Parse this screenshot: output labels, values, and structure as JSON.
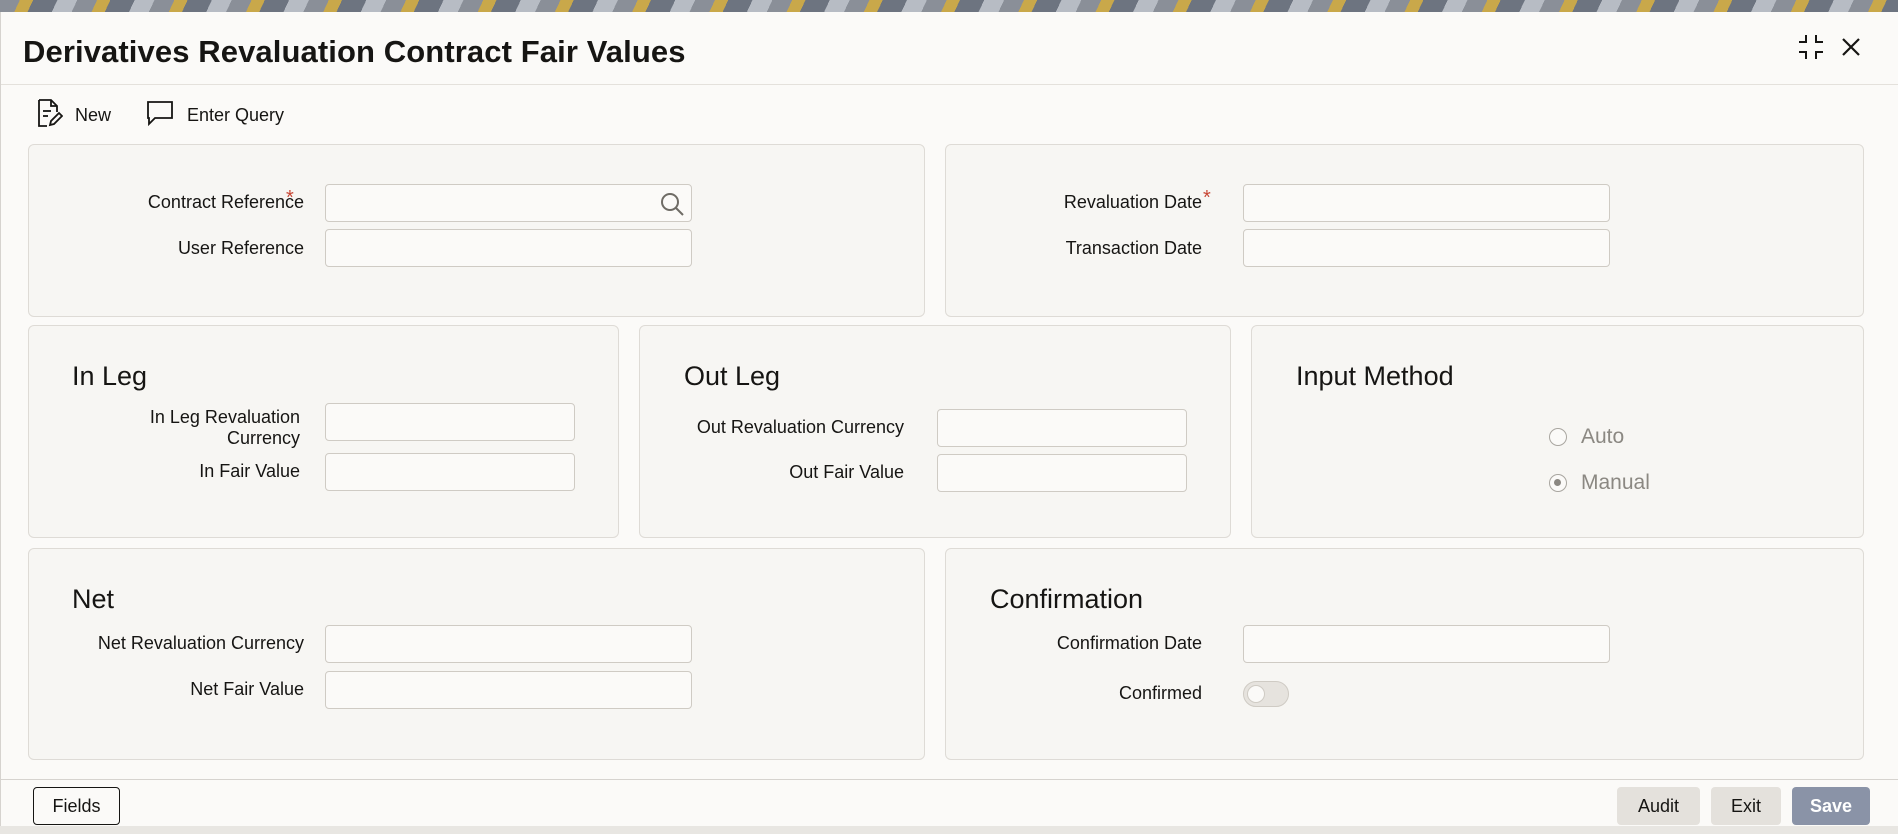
{
  "window": {
    "title": "Derivatives Revaluation Contract Fair Values"
  },
  "toolbar": {
    "new_label": "New",
    "enter_query_label": "Enter Query"
  },
  "header_panel": {
    "contract_reference_label": "Contract Reference",
    "user_reference_label": "User Reference",
    "revaluation_date_label": "Revaluation Date",
    "transaction_date_label": "Transaction Date",
    "required_mark": "*",
    "contract_reference_value": "",
    "user_reference_value": "",
    "revaluation_date_value": "",
    "transaction_date_value": ""
  },
  "in_leg": {
    "title": "In Leg",
    "currency_label_line1": "In Leg Revaluation",
    "currency_label_line2": "Currency",
    "fair_value_label": "In Fair Value",
    "currency_value": "",
    "fair_value": ""
  },
  "out_leg": {
    "title": "Out Leg",
    "currency_label": "Out Revaluation Currency",
    "fair_value_label": "Out Fair Value",
    "currency_value": "",
    "fair_value": ""
  },
  "input_method": {
    "title": "Input Method",
    "options": [
      "Auto",
      "Manual"
    ],
    "selected": "Manual"
  },
  "net": {
    "title": "Net",
    "currency_label": "Net Revaluation Currency",
    "fair_value_label": "Net Fair Value",
    "currency_value": "",
    "fair_value": ""
  },
  "confirmation": {
    "title": "Confirmation",
    "date_label": "Confirmation Date",
    "confirmed_label": "Confirmed",
    "date_value": "",
    "confirmed": false
  },
  "footer": {
    "fields_label": "Fields",
    "audit_label": "Audit",
    "exit_label": "Exit",
    "save_label": "Save"
  },
  "colors": {
    "required": "#c74634",
    "save_button": "#8a93a7",
    "panel_bg": "#f7f6f3"
  }
}
